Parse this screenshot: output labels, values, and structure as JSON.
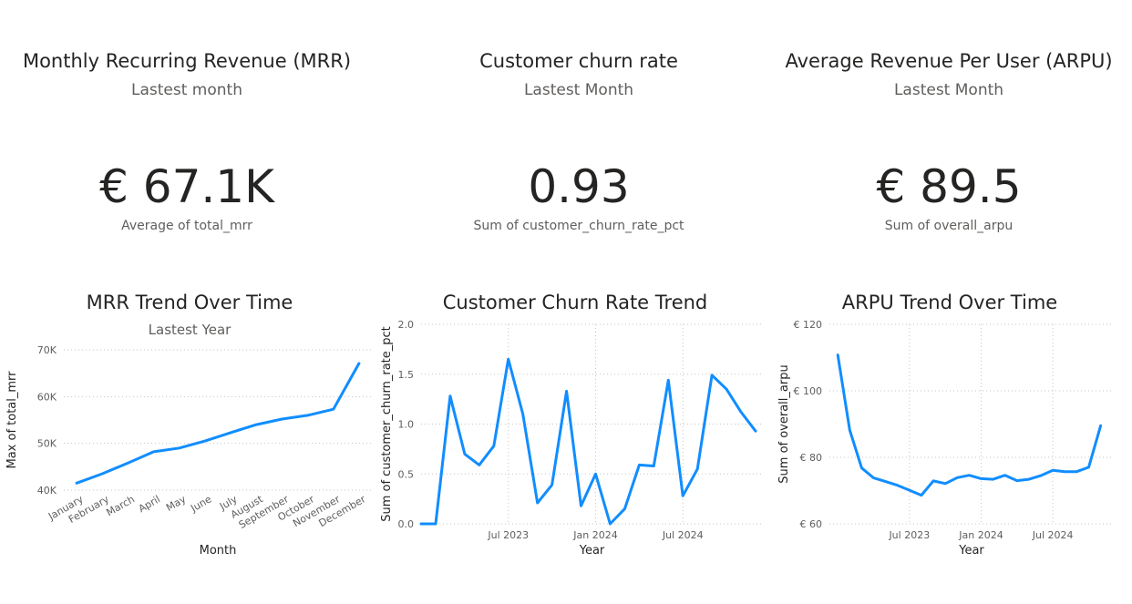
{
  "kpis": [
    {
      "title": "Monthly Recurring Revenue (MRR)",
      "subtitle": "Lastest month",
      "value": "€ 67.1K",
      "label": "Average of total_mrr"
    },
    {
      "title": "Customer churn rate",
      "subtitle": "Lastest Month",
      "value": "0.93",
      "label": "Sum of customer_churn_rate_pct"
    },
    {
      "title": "Average Revenue Per User (ARPU)",
      "subtitle": "Lastest Month",
      "value": "€ 89.5",
      "label": "Sum of overall_arpu"
    }
  ],
  "colors": {
    "line": "#118DFF",
    "grid": "#c8c6c4",
    "axis_text": "#605e5c",
    "title": "#252423"
  },
  "chart_data": [
    {
      "type": "line",
      "title": "MRR Trend Over Time",
      "subtitle": "Lastest Year",
      "xlabel": "Month",
      "ylabel": "Max of total_mrr",
      "categories": [
        "January",
        "February",
        "March",
        "April",
        "May",
        "June",
        "July",
        "August",
        "September",
        "October",
        "November",
        "December"
      ],
      "values": [
        41500,
        43500,
        45800,
        48200,
        49000,
        50500,
        52300,
        54000,
        55200,
        56000,
        57300,
        67100
      ],
      "ylim": [
        40000,
        70000
      ],
      "yticks": [
        {
          "v": 40000,
          "label": "40K"
        },
        {
          "v": 50000,
          "label": "50K"
        },
        {
          "v": 60000,
          "label": "60K"
        },
        {
          "v": 70000,
          "label": "70K"
        }
      ],
      "grid": true
    },
    {
      "type": "line",
      "title": "Customer Churn Rate Trend",
      "xlabel": "Year",
      "ylabel": "Sum of customer_churn_rate_pct",
      "x": [
        "2023-01",
        "2023-02",
        "2023-03",
        "2023-04",
        "2023-05",
        "2023-06",
        "2023-07",
        "2023-08",
        "2023-09",
        "2023-10",
        "2023-11",
        "2023-12",
        "2024-01",
        "2024-02",
        "2024-03",
        "2024-04",
        "2024-05",
        "2024-06",
        "2024-07",
        "2024-08",
        "2024-09",
        "2024-10",
        "2024-11",
        "2024-12"
      ],
      "values": [
        0.0,
        0.0,
        1.28,
        0.7,
        0.59,
        0.78,
        1.65,
        1.1,
        0.21,
        0.39,
        1.33,
        0.18,
        0.5,
        0.0,
        0.15,
        0.59,
        0.58,
        1.44,
        0.28,
        0.55,
        1.49,
        1.35,
        1.12,
        0.93
      ],
      "ylim": [
        0,
        2.0
      ],
      "yticks": [
        {
          "v": 0,
          "label": "0.0"
        },
        {
          "v": 0.5,
          "label": "0.5"
        },
        {
          "v": 1.0,
          "label": "1.0"
        },
        {
          "v": 1.5,
          "label": "1.5"
        },
        {
          "v": 2.0,
          "label": "2.0"
        }
      ],
      "xticks": [
        {
          "v": "2023-07",
          "label": "Jul 2023"
        },
        {
          "v": "2024-01",
          "label": "Jan 2024"
        },
        {
          "v": "2024-07",
          "label": "Jul 2024"
        }
      ],
      "grid": true
    },
    {
      "type": "line",
      "title": "ARPU Trend Over Time",
      "xlabel": "Year",
      "ylabel": "Sum of overall_arpu",
      "x": [
        "2023-01",
        "2023-02",
        "2023-03",
        "2023-04",
        "2023-05",
        "2023-06",
        "2023-07",
        "2023-08",
        "2023-09",
        "2023-10",
        "2023-11",
        "2023-12",
        "2024-01",
        "2024-02",
        "2024-03",
        "2024-04",
        "2024-05",
        "2024-06",
        "2024-07",
        "2024-08",
        "2024-09",
        "2024-10",
        "2024-11",
        "2024-12"
      ],
      "values": [
        110.8,
        88.2,
        76.8,
        73.8,
        72.7,
        71.6,
        70.1,
        68.6,
        72.9,
        72.1,
        73.9,
        74.6,
        73.6,
        73.4,
        74.6,
        73.0,
        73.4,
        74.5,
        76.1,
        75.7,
        75.7,
        77.0,
        89.5
      ],
      "ylim": [
        60,
        120
      ],
      "yticks": [
        {
          "v": 60,
          "label": "€ 60"
        },
        {
          "v": 80,
          "label": "€ 80"
        },
        {
          "v": 100,
          "label": "€ 100"
        },
        {
          "v": 120,
          "label": "€ 120"
        }
      ],
      "xticks": [
        {
          "v": "2023-07",
          "label": "Jul 2023"
        },
        {
          "v": "2024-01",
          "label": "Jan 2024"
        },
        {
          "v": "2024-07",
          "label": "Jul 2024"
        }
      ],
      "grid": true
    }
  ]
}
